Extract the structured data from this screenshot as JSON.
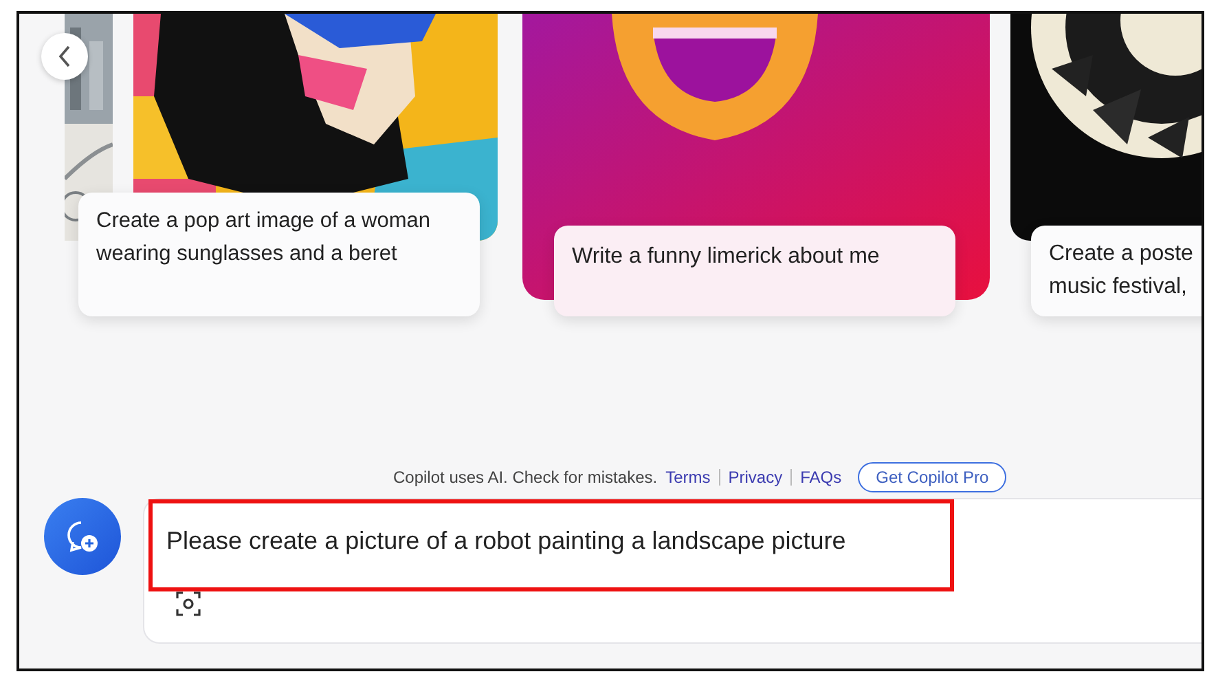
{
  "suggestions": [
    {
      "kind": "street"
    },
    {
      "kind": "popart",
      "caption": "Create a pop art image of a woman wearing sunglasses and a beret"
    },
    {
      "kind": "smiley",
      "caption": "Write a funny limerick about me"
    },
    {
      "kind": "poster",
      "caption": "Create a poste\nmusic festival,"
    }
  ],
  "footer": {
    "notice": "Copilot uses AI. Check for mistakes.",
    "links": [
      "Terms",
      "Privacy",
      "FAQs"
    ],
    "pro_button": "Get Copilot Pro"
  },
  "composer": {
    "value": "Please create a picture of a robot painting a landscape picture",
    "highlighted": true
  }
}
